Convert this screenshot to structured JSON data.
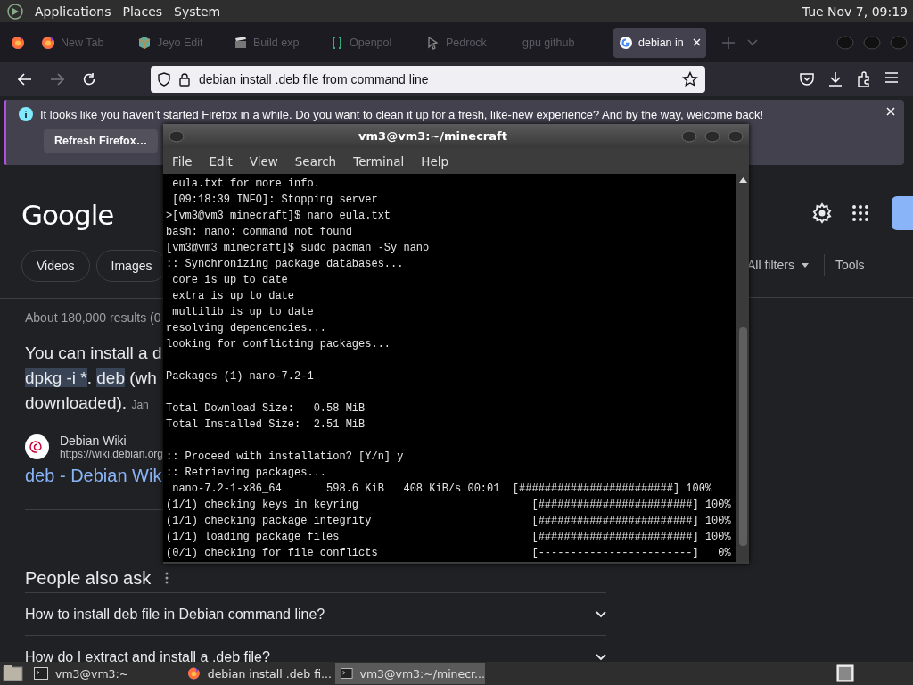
{
  "top_panel": {
    "menus": [
      "Applications",
      "Places",
      "System"
    ],
    "clock": "Tue Nov 7, 09:19"
  },
  "browser": {
    "tabs": [
      {
        "label": "New Tab",
        "selected": false,
        "kind": "firefox"
      },
      {
        "label": "Jeyo Edit",
        "selected": false,
        "kind": "cube"
      },
      {
        "label": "Build exp",
        "selected": false,
        "kind": "clapper"
      },
      {
        "label": "Openpol",
        "selected": false,
        "kind": "bracket"
      },
      {
        "label": "Pedrock",
        "selected": false,
        "kind": "cursor"
      },
      {
        "label": "gpu github",
        "selected": false,
        "kind": "blank"
      },
      {
        "label": "debian in",
        "selected": true,
        "kind": "google"
      }
    ],
    "address": "debian install .deb file from command line",
    "notification": {
      "message": "It looks like you haven’t started Firefox in a while. Do you want to clean it up for a fresh, like-new experience? And by the way, welcome back!",
      "button": "Refresh Firefox…"
    },
    "page": {
      "logo": "Google",
      "filters": [
        "Videos",
        "Images"
      ],
      "more_filters": "All filters",
      "tools": "Tools",
      "result_stats": "About 180,000 results (0",
      "answer": [
        [
          {
            "text": "You can install a d",
            "highlighted": false
          }
        ],
        [
          {
            "text": "dpkg -i *",
            "highlighted": true
          },
          {
            "text": ". ",
            "highlighted": false
          },
          {
            "text": "deb",
            "highlighted": true
          },
          {
            "text": " (wh",
            "highlighted": false
          }
        ],
        [
          {
            "text": "downloaded). ",
            "highlighted": false
          }
        ]
      ],
      "answer_date": "Jan",
      "source": {
        "name": "Debian Wiki",
        "url": "https://wiki.debian.org",
        "title": "deb - Debian Wik"
      },
      "people_also_ask": {
        "title": "People also ask",
        "questions": [
          "How to install deb file in Debian command line?",
          "How do I extract and install a .deb file?"
        ]
      }
    }
  },
  "terminal": {
    "title": "vm3@vm3:~/minecraft",
    "menus": [
      "File",
      "Edit",
      "View",
      "Search",
      "Terminal",
      "Help"
    ],
    "output": " eula.txt for more info.\n [09:18:39 INFO]: Stopping server\n>[vm3@vm3 minecraft]$ nano eula.txt\nbash: nano: command not found\n[vm3@vm3 minecraft]$ sudo pacman -Sy nano\n:: Synchronizing package databases...\n core is up to date\n extra is up to date\n multilib is up to date\nresolving dependencies...\nlooking for conflicting packages...\n\nPackages (1) nano-7.2-1\n\nTotal Download Size:   0.58 MiB\nTotal Installed Size:  2.51 MiB\n\n:: Proceed with installation? [Y/n] y\n:: Retrieving packages...\n nano-7.2-1-x86_64       598.6 KiB   408 KiB/s 00:01  [########################] 100%\n(1/1) checking keys in keyring                           [########################] 100%\n(1/1) checking package integrity                         [########################] 100%\n(1/1) loading package files                              [########################] 100%\n(0/1) checking for file conflicts                        [------------------------]   0%"
  },
  "taskbar": {
    "items": [
      {
        "label": "vm3@vm3:~",
        "kind": "terminal",
        "selected": false
      },
      {
        "label": "debian install .deb fi...",
        "kind": "firefox",
        "selected": false
      },
      {
        "label": "vm3@vm3:~/minecr...",
        "kind": "terminal",
        "selected": true
      }
    ]
  }
}
